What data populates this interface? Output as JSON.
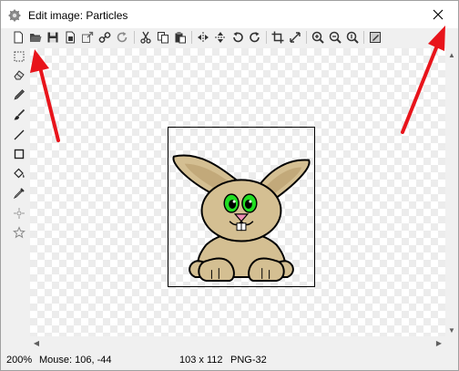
{
  "window": {
    "title": "Edit image: Particles",
    "close_label": "✕"
  },
  "toolbar": {
    "items": [
      {
        "name": "new-icon"
      },
      {
        "name": "open-folder-icon"
      },
      {
        "name": "save-icon"
      },
      {
        "name": "save-as-icon"
      },
      {
        "name": "export-icon"
      },
      {
        "name": "link-icon"
      },
      {
        "name": "refresh-icon"
      },
      {
        "name": "cut-icon"
      },
      {
        "name": "copy-icon"
      },
      {
        "name": "paste-icon"
      },
      {
        "name": "flip-horizontal-icon"
      },
      {
        "name": "flip-vertical-icon"
      },
      {
        "name": "rotate-left-icon"
      },
      {
        "name": "rotate-right-icon"
      },
      {
        "name": "crop-icon"
      },
      {
        "name": "resize-icon"
      },
      {
        "name": "zoom-in-icon"
      },
      {
        "name": "zoom-out-icon"
      },
      {
        "name": "zoom-reset-icon"
      },
      {
        "name": "edit-properties-icon"
      }
    ]
  },
  "tools": [
    {
      "name": "select-rect-icon"
    },
    {
      "name": "eraser-icon"
    },
    {
      "name": "pencil-icon"
    },
    {
      "name": "brush-icon"
    },
    {
      "name": "line-icon"
    },
    {
      "name": "rectangle-icon"
    },
    {
      "name": "fill-bucket-icon"
    },
    {
      "name": "color-picker-icon"
    },
    {
      "name": "spray-icon"
    },
    {
      "name": "star-icon"
    }
  ],
  "status": {
    "zoom": "200%",
    "mouse": "Mouse: 106, -44",
    "size": "103 x 112",
    "format": "PNG-32"
  },
  "colors": {
    "annotation_arrow": "#e8141b",
    "bunny_fur": "#d4bf92",
    "bunny_inner_ear": "#c9b285",
    "bunny_eye": "#22dd22",
    "bunny_nose": "#f08cb4"
  }
}
